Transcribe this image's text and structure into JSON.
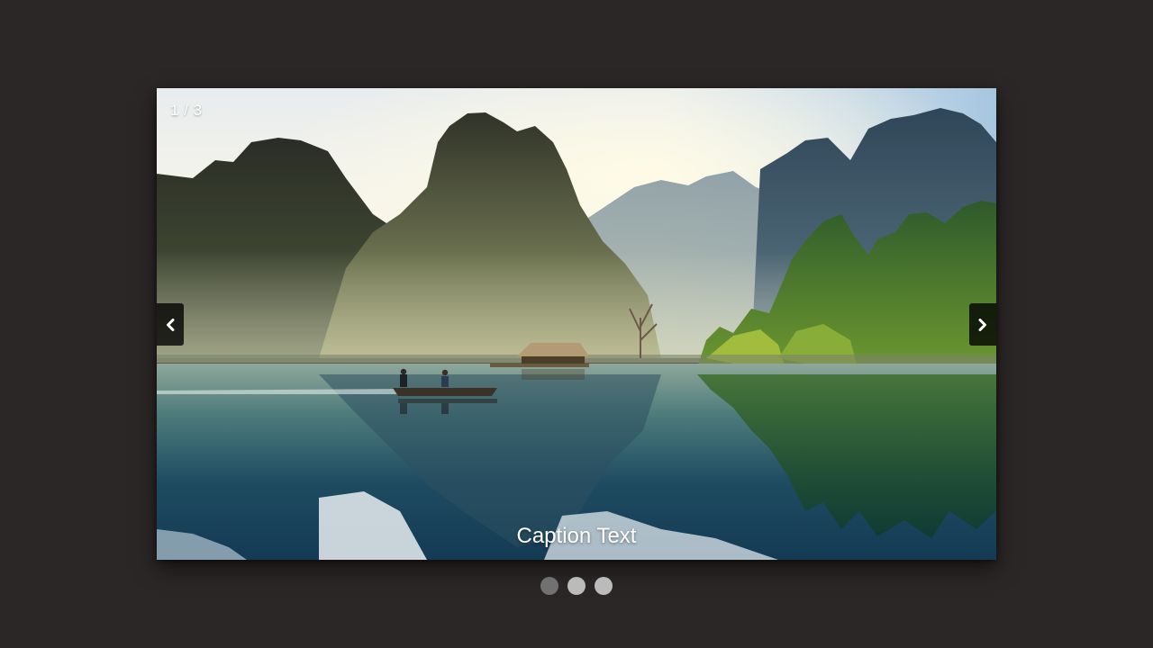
{
  "slideshow": {
    "counter": "1 / 3",
    "caption": "Caption Text",
    "current_slide": 1,
    "total_slides": 3,
    "prev_icon": "chevron-left-icon",
    "next_icon": "chevron-right-icon"
  },
  "dots": [
    {
      "index": 1,
      "active": true
    },
    {
      "index": 2,
      "active": false
    },
    {
      "index": 3,
      "active": false
    }
  ],
  "colors": {
    "page_background": "#2c2727",
    "nav_button_background": "#000000",
    "dot_active": "#717171",
    "dot_inactive": "#bbbbbb",
    "text": "#ffffff"
  }
}
